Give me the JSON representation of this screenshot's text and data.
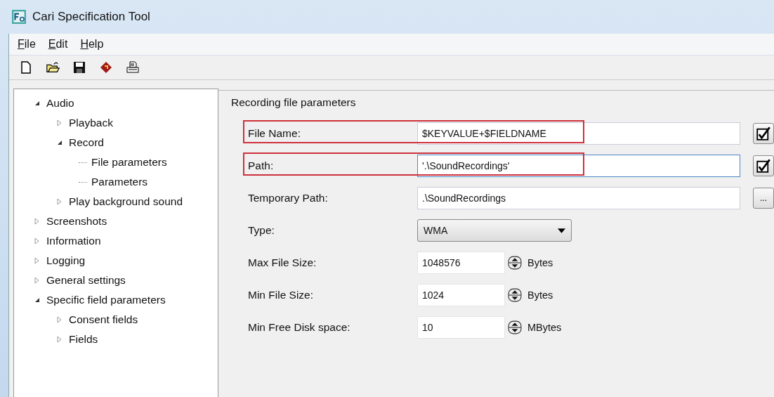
{
  "window": {
    "title": "Cari Specification Tool"
  },
  "menu": [
    {
      "label": "File"
    },
    {
      "label": "Edit"
    },
    {
      "label": "Help"
    }
  ],
  "toolbar": [
    {
      "kind": "new"
    },
    {
      "kind": "open"
    },
    {
      "kind": "save"
    },
    {
      "kind": "tag"
    },
    {
      "kind": "print"
    }
  ],
  "tree": [
    {
      "label": "Audio",
      "expanded": true,
      "children": [
        {
          "label": "Playback",
          "expanded": false
        },
        {
          "label": "Record",
          "expanded": true,
          "children": [
            {
              "label": "File parameters"
            },
            {
              "label": "Parameters"
            }
          ]
        },
        {
          "label": "Play background sound",
          "expanded": false
        }
      ]
    },
    {
      "label": "Screenshots",
      "expanded": false
    },
    {
      "label": "Information",
      "expanded": false
    },
    {
      "label": "Logging",
      "expanded": false
    },
    {
      "label": "General settings",
      "expanded": false
    },
    {
      "label": "Specific field parameters",
      "expanded": true,
      "children": [
        {
          "label": "Consent fields",
          "expanded": false
        },
        {
          "label": "Fields",
          "expanded": false
        }
      ]
    }
  ],
  "group": {
    "title": "Recording file parameters",
    "fields": [
      {
        "kind": "text",
        "label": "File Name:",
        "value": "$KEYVALUE+$FIELDNAME",
        "highlighted": true,
        "button": {
          "kind": "check",
          "checked": true
        }
      },
      {
        "kind": "text",
        "label": "Path:",
        "value": "'.\\SoundRecordings'",
        "highlighted": true,
        "focused": true,
        "button": {
          "kind": "check",
          "checked": true
        }
      },
      {
        "kind": "text",
        "label": "Temporary Path:",
        "value": ".\\SoundRecordings",
        "highlighted": false,
        "button": {
          "kind": "browse",
          "label": "..."
        }
      },
      {
        "kind": "select",
        "label": "Type:",
        "value": "WMA",
        "highlighted": false
      },
      {
        "kind": "spin",
        "label": "Max File Size:",
        "value": "1048576",
        "unit": "Bytes",
        "highlighted": false
      },
      {
        "kind": "spin",
        "label": "Min File Size:",
        "value": "1024",
        "unit": "Bytes",
        "highlighted": false
      },
      {
        "kind": "spin",
        "label": "Min Free Disk space:",
        "value": "10",
        "unit": "MBytes",
        "highlighted": false
      }
    ]
  }
}
